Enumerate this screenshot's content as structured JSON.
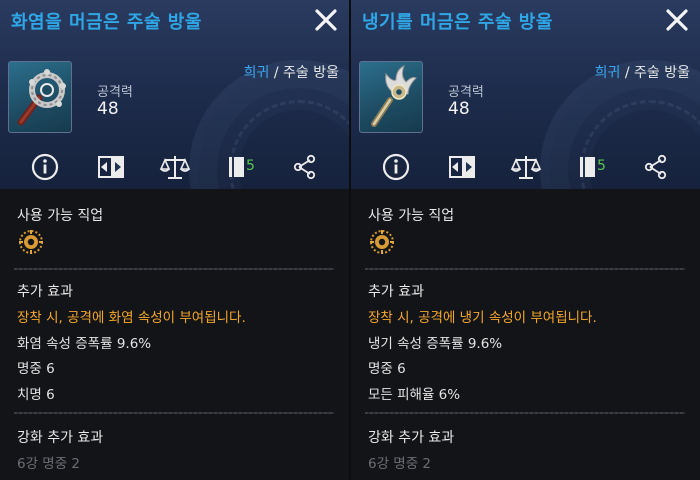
{
  "panels": [
    {
      "title": "화염을 머금은 주술 방울",
      "rarity": "희귀",
      "separator": " / ",
      "type": "주술 방울",
      "stat_label": "공격력",
      "stat_value": "48",
      "tool_count": "5",
      "usable_class_title": "사용 가능 직업",
      "extra_title": "추가 효과",
      "extra_desc": "장착 시, 공격에 화염 속성이 부여됩니다.",
      "effects": [
        "화염 속성 증폭률 9.6%",
        "명중 6",
        "치명 6"
      ],
      "enhance_title": "강화 추가 효과",
      "enhance_line": "6강 명중 2"
    },
    {
      "title": "냉기를 머금은 주술 방울",
      "rarity": "희귀",
      "separator": " / ",
      "type": "주술 방울",
      "stat_label": "공격력",
      "stat_value": "48",
      "tool_count": "5",
      "usable_class_title": "사용 가능 직업",
      "extra_title": "추가 효과",
      "extra_desc": "장착 시, 공격에 냉기 속성이 부여됩니다.",
      "effects": [
        "냉기 속성 증폭률 9.6%",
        "명중 6",
        "모든 피해율 6%"
      ],
      "enhance_title": "강화 추가 효과",
      "enhance_line": "6강 명중 2"
    }
  ],
  "colors": {
    "title": "#2fa7e6",
    "rarity": "#3aa6f0",
    "desc_gold": "#f3a72a",
    "count_green": "#56c84e"
  },
  "icons": [
    "close-icon",
    "info-icon",
    "compare-icon",
    "scale-icon",
    "book-icon",
    "share-icon",
    "class-emblem-icon"
  ]
}
